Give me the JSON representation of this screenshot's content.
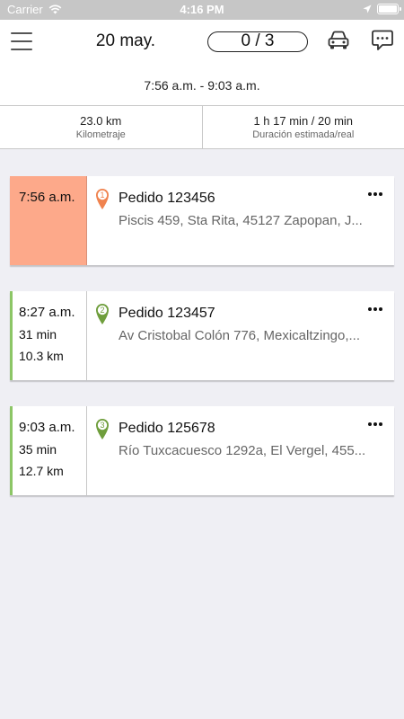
{
  "status_bar": {
    "carrier": "Carrier",
    "time": "4:16 PM"
  },
  "header": {
    "menu_icon": "hamburger-menu-icon",
    "date": "20 may.",
    "progress": "0 / 3",
    "car_icon": "car-icon",
    "chat_icon": "chat-icon"
  },
  "route": {
    "time_range": "7:56 a.m. - 9:03 a.m.",
    "distance_value": "23.0 km",
    "distance_label": "Kilometraje",
    "duration_value": "1 h 17 min / 20 min",
    "duration_label": "Duración estimada/real"
  },
  "stops": [
    {
      "time": "7:56 a.m.",
      "number": "1",
      "title": "Pedido 123456",
      "address": "Piscis 459, Sta Rita, 45127 Zapopan, J...",
      "pin_color": "#f0834f",
      "highlight_color": "#fda98a"
    },
    {
      "time": "8:27 a.m.",
      "duration": "31 min",
      "distance": "10.3 km",
      "number": "2",
      "title": "Pedido 123457",
      "address": "Av Cristobal Colón 776, Mexicaltzingo,...",
      "pin_color": "#6f9e3c"
    },
    {
      "time": "9:03 a.m.",
      "duration": "35 min",
      "distance": "12.7 km",
      "number": "3",
      "title": "Pedido 125678",
      "address": "Río Tuxcacuesco 1292a, El Vergel, 455...",
      "pin_color": "#6f9e3c"
    }
  ],
  "colors": {
    "accent_green": "#8cc666",
    "accent_orange": "#fda98a",
    "background": "#efeff4"
  }
}
